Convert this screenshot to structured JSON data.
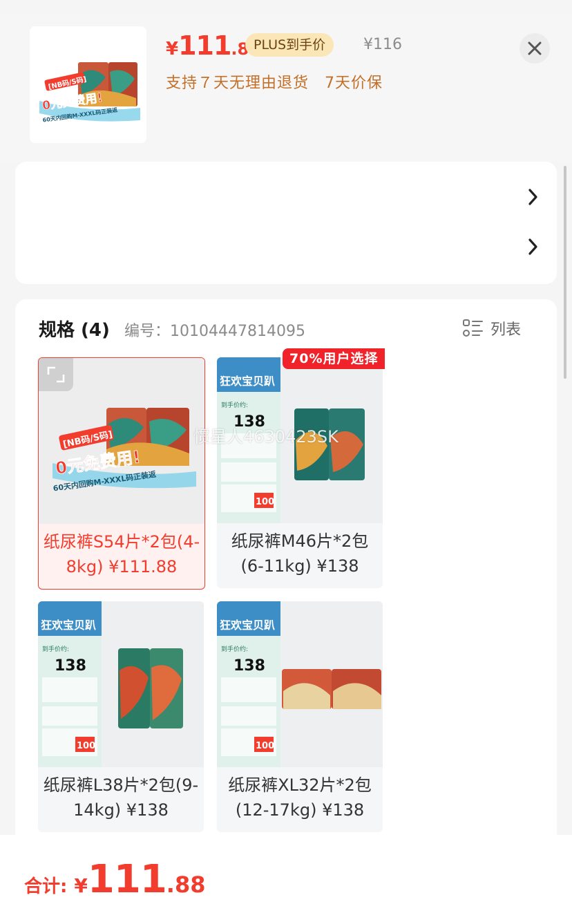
{
  "header": {
    "price_symbol": "¥",
    "price_int": "111",
    "price_dec": ".88",
    "plus_badge": "PLUS到手价",
    "original_price": "¥116",
    "service_line": "支持７天无理由退货　7天价保",
    "thumb_overlay_line1": "[NB码/S码]",
    "thumb_overlay_line2": "0元免费用!",
    "thumb_overlay_line3": "60天内回购M-XXXL码正装返"
  },
  "spec": {
    "title": "规格 (4)",
    "code_label": "编号：",
    "code_value": "10104447814095",
    "list_toggle_label": "列表",
    "hot_badge": "70%用户选择",
    "watermark": "惯星人4630423SK",
    "items": [
      {
        "label": "纸尿裤S54片*2包(4-8kg) ¥111.88",
        "selected": true
      },
      {
        "label": "纸尿裤M46片*2包(6-11kg) ¥138",
        "selected": false
      },
      {
        "label": "纸尿裤L38片*2包(9-14kg) ¥138",
        "selected": false
      },
      {
        "label": "纸尿裤XL32片*2包(12-17kg) ¥138",
        "selected": false
      }
    ],
    "promo_img": {
      "banner": "狂欢宝贝趴",
      "price_caption": "到手价约:",
      "price_value": "138",
      "coupon_value": "100"
    }
  },
  "bottom": {
    "total_label": "合计:",
    "total_symbol": "¥",
    "total_int": "111",
    "total_dec": ".88"
  },
  "colors": {
    "accent_red": "#f23c2d",
    "plus_badge_bg": "#fbe6b7",
    "service_orange": "#c46f28",
    "hot_badge_bg": "#f0232b"
  },
  "icons": [
    "close-icon",
    "chevron-right-icon",
    "expand-icon",
    "list-view-icon"
  ]
}
